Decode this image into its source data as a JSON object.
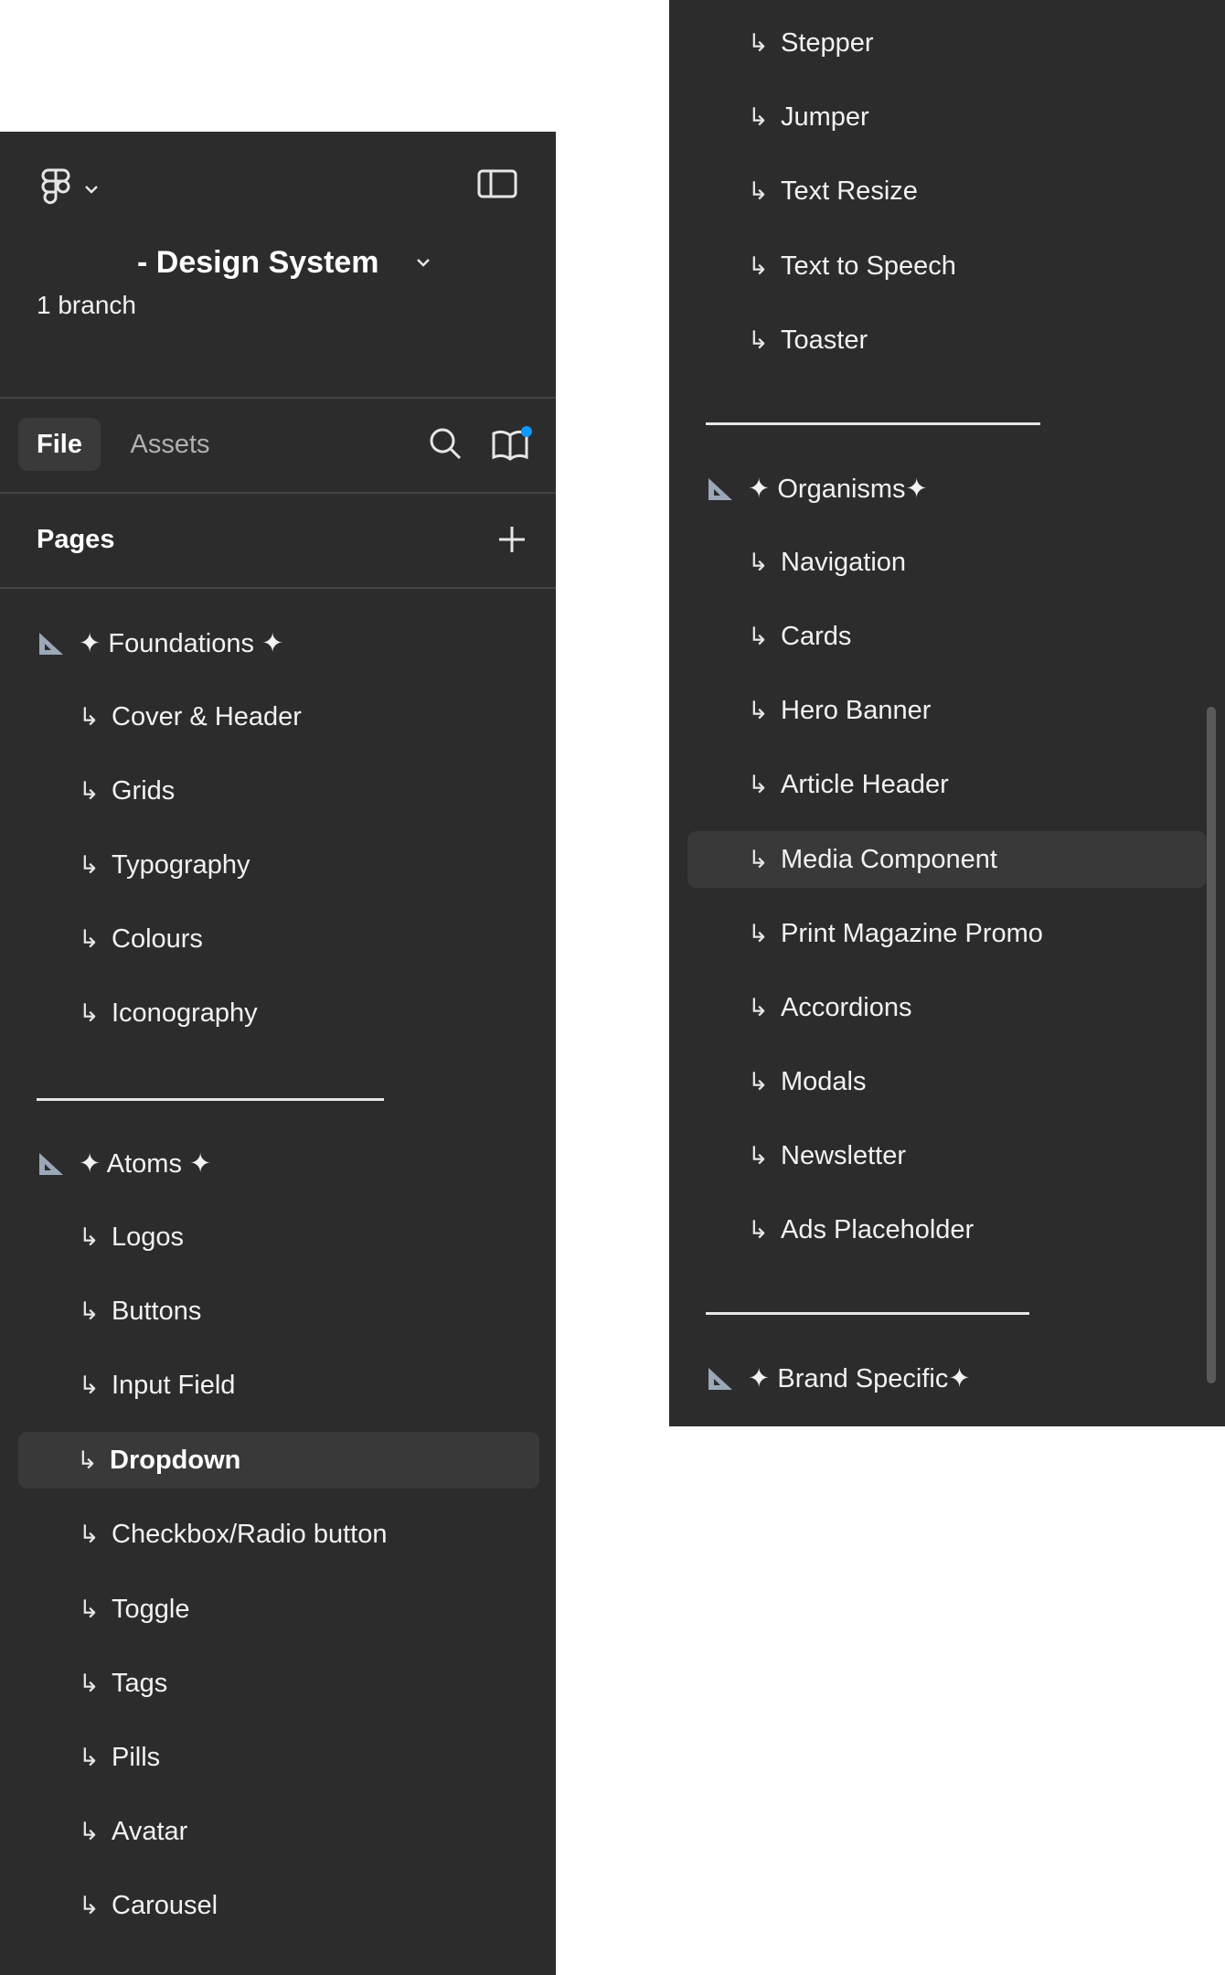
{
  "header": {
    "file_title": "- Design System",
    "branch_count": "1 branch"
  },
  "tabs": [
    {
      "label": "File",
      "active": true
    },
    {
      "label": "Assets",
      "active": false
    }
  ],
  "pages_header": {
    "label": "Pages"
  },
  "left_list": {
    "foundations": {
      "title": "✦ Foundations ✦",
      "items": [
        "Cover & Header",
        "Grids",
        "Typography",
        "Colours",
        "Iconography"
      ]
    },
    "atoms": {
      "title": "✦ Atoms ✦",
      "items": [
        "Logos",
        "Buttons",
        "Input Field",
        "Dropdown",
        "Checkbox/Radio button",
        "Toggle",
        "Tags",
        "Pills",
        "Avatar",
        "Carousel"
      ],
      "selected": "Dropdown"
    }
  },
  "right_list": {
    "molecules_tail": [
      "Stepper",
      "Jumper",
      "Text Resize",
      "Text to Speech",
      "Toaster"
    ],
    "organisms": {
      "title": "✦ Organisms✦",
      "items": [
        "Navigation",
        "Cards",
        "Hero Banner",
        "Article Header",
        "Media Component",
        "Print Magazine Promo",
        "Accordions",
        "Modals",
        "Newsletter",
        "Ads Placeholder"
      ],
      "hovered": "Media Component"
    },
    "brand_specific": {
      "title": "✦ Brand Specific✦"
    }
  },
  "icons": {
    "figma": "figma-logo-icon",
    "sidebar_toggle": "sidebar-toggle-icon",
    "search": "search-icon",
    "library": "library-book-icon",
    "add": "plus-icon",
    "section": "triangle-ruler-icon",
    "child": "return-arrow-icon"
  },
  "colors": {
    "panel_bg": "#2c2c2c",
    "selected_row_bg": "#393939",
    "notification_dot": "#0d99ff",
    "text": "#f2f2f2"
  }
}
